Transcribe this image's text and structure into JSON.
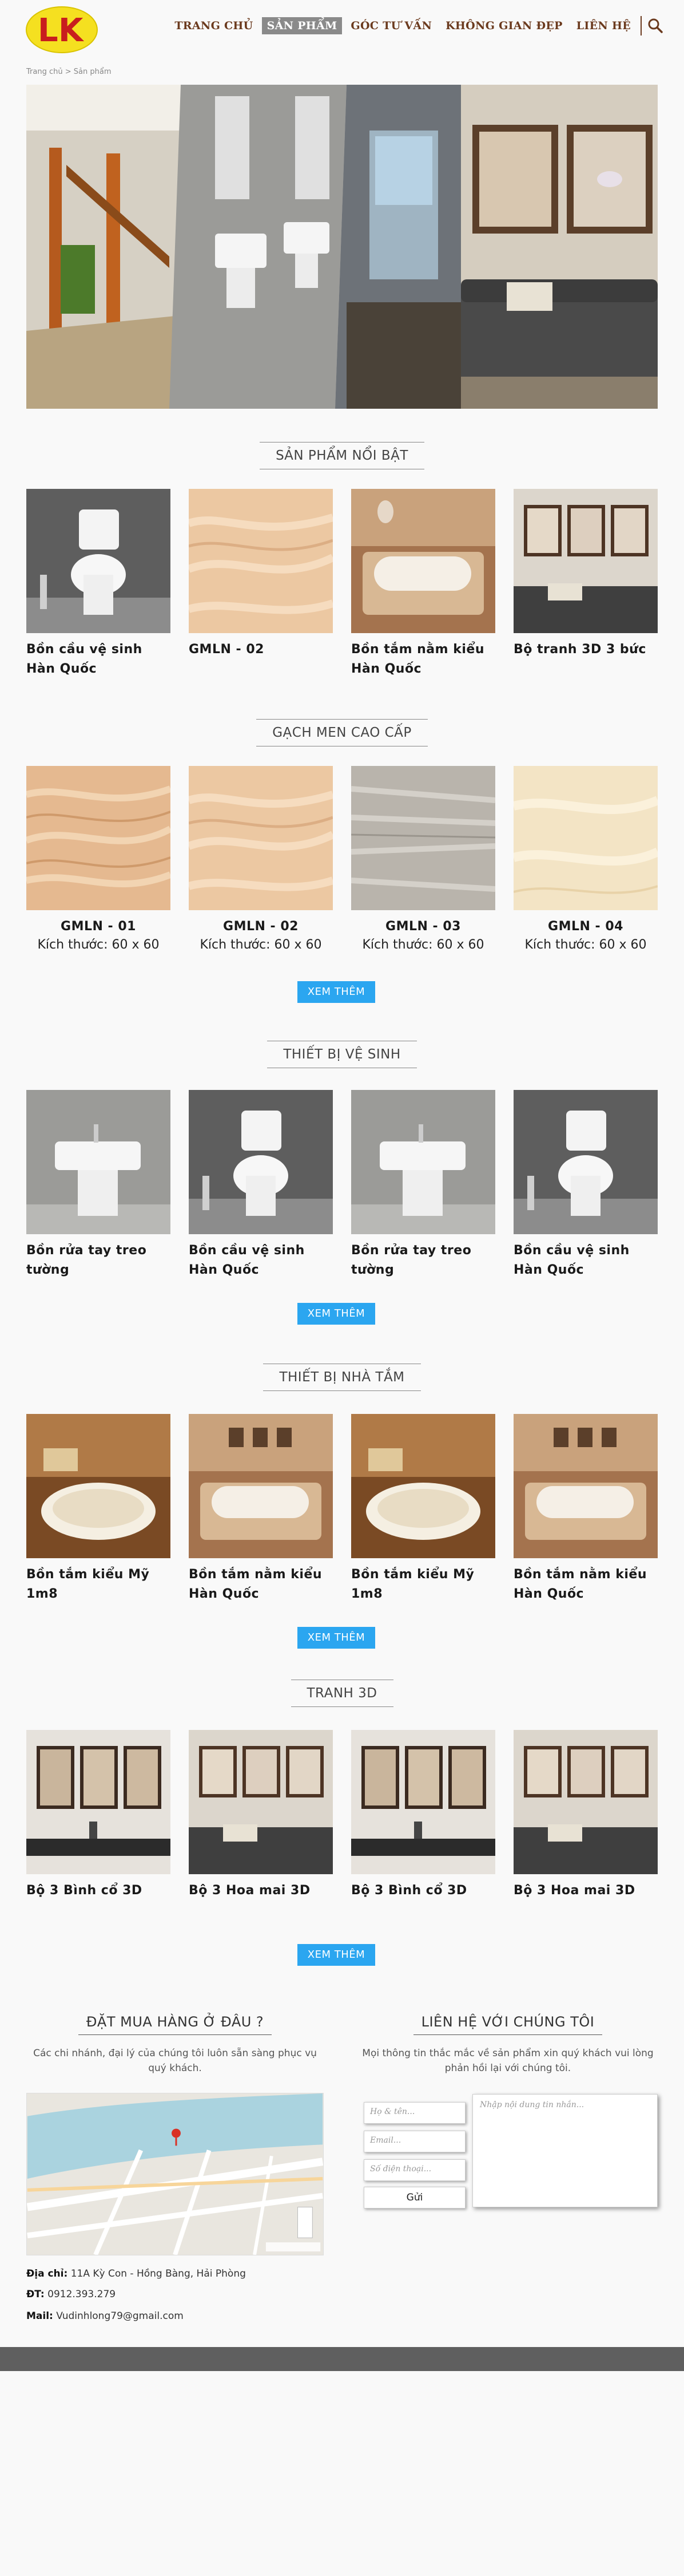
{
  "header": {
    "logo_text": "LK",
    "nav": [
      {
        "label": "TRANG CHỦ",
        "active": false
      },
      {
        "label": "SẢN PHẨM",
        "active": true
      },
      {
        "label": "GÓC TƯ VẤN",
        "active": false
      },
      {
        "label": "KHÔNG GIAN ĐẸP",
        "active": false
      },
      {
        "label": "LIÊN HỆ",
        "active": false
      }
    ],
    "search_icon": "search-icon"
  },
  "breadcrumb": {
    "home": "Trang chủ",
    "separator": ">",
    "current": "Sản phẩm"
  },
  "featured": {
    "title": "SẢN PHẨM NỔI BẬT",
    "items": [
      {
        "name": "Bồn cầu vệ sinh Hàn Quốc"
      },
      {
        "name": "GMLN - 02"
      },
      {
        "name": "Bồn tắm nằm kiểu Hàn Quốc"
      },
      {
        "name": "Bộ tranh 3D 3 bức"
      }
    ]
  },
  "tiles": {
    "title": "GẠCH MEN CAO CẤP",
    "items": [
      {
        "name": "GMLN - 01",
        "size": "Kích thước: 60 x 60"
      },
      {
        "name": "GMLN - 02",
        "size": "Kích thước: 60 x 60"
      },
      {
        "name": "GMLN - 03",
        "size": "Kích thước: 60 x 60"
      },
      {
        "name": "GMLN - 04",
        "size": "Kích thước: 60 x 60"
      }
    ],
    "more": "XEM THÊM"
  },
  "sanitary": {
    "title": "THIẾT BỊ VỆ SINH",
    "items": [
      {
        "name": "Bồn rửa tay treo tường"
      },
      {
        "name": "Bồn cầu vệ sinh Hàn Quốc"
      },
      {
        "name": "Bồn rửa tay treo tường"
      },
      {
        "name": "Bồn cầu vệ sinh Hàn Quốc"
      }
    ],
    "more": "XEM THÊM"
  },
  "bath": {
    "title": "THIẾT BỊ NHÀ TẮM",
    "items": [
      {
        "name": "Bồn tắm kiểu Mỹ 1m8"
      },
      {
        "name": "Bồn tắm nằm kiểu Hàn Quốc"
      },
      {
        "name": "Bồn tắm kiểu Mỹ 1m8"
      },
      {
        "name": "Bồn tắm nằm kiểu Hàn Quốc"
      }
    ],
    "more": "XEM THÊM"
  },
  "art": {
    "title": "TRANH 3D",
    "items": [
      {
        "name": "Bộ 3 Bình cổ 3D"
      },
      {
        "name": "Bộ 3 Hoa mai 3D"
      },
      {
        "name": "Bộ 3 Bình cổ 3D"
      },
      {
        "name": "Bộ 3 Hoa mai 3D"
      }
    ],
    "more": "XEM THÊM"
  },
  "where": {
    "title": "ĐẶT MUA HÀNG Ở ĐÂU ?",
    "subtitle": "Các chi nhánh, đại lý của chúng tôi luôn sẵn sàng phục vụ quý khách.",
    "address_label": "Địa chỉ:",
    "address": "11A Kỳ Con - Hồng Bàng, Hải Phòng",
    "phone_label": "ĐT:",
    "phone": "0912.393.279",
    "mail_label": "Mail:",
    "mail": "Vudinhlong79@gmail.com"
  },
  "contact": {
    "title": "LIÊN HỆ VỚI CHÚNG TÔI",
    "subtitle": "Mọi thông tin thắc mắc về sản phẩm xin quý khách vui lòng phản hồi lại với chúng tôi.",
    "name_placeholder": "Họ & tên...",
    "email_placeholder": "Email...",
    "phone_placeholder": "Số điện thoại...",
    "message_placeholder": "Nhập nội dung tin nhắn...",
    "submit": "Gửi"
  },
  "colors": {
    "accent": "#2ba6f0",
    "nav_text": "#6b3a1e",
    "footer": "#5f5f5f",
    "logo_yellow": "#f5e020",
    "logo_red": "#c81e1e"
  }
}
